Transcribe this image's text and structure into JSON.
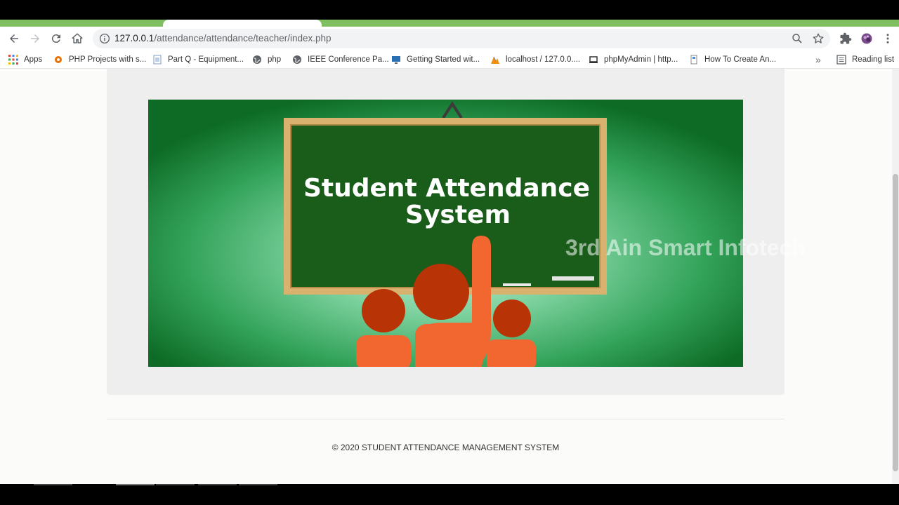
{
  "browser": {
    "url_host": "127.0.0.1",
    "url_path": "/attendance/attendance/teacher/index.php",
    "bookmarks": [
      {
        "label": "Apps",
        "icon": "apps-grid-icon"
      },
      {
        "label": "PHP Projects with s...",
        "icon": "php-projects-icon"
      },
      {
        "label": "Part Q - Equipment...",
        "icon": "document-icon"
      },
      {
        "label": "php",
        "icon": "globe-icon"
      },
      {
        "label": "IEEE Conference Pa...",
        "icon": "globe-icon"
      },
      {
        "label": "Getting Started wit...",
        "icon": "monitor-icon"
      },
      {
        "label": "localhost / 127.0.0....",
        "icon": "phpmyadmin-icon"
      },
      {
        "label": "phpMyAdmin | http...",
        "icon": "laptop-icon"
      },
      {
        "label": "How To Create An...",
        "icon": "page-icon"
      }
    ],
    "overflow_label": "»",
    "reading_list_label": "Reading list"
  },
  "banner": {
    "title_line1": "Student Attendance",
    "title_line2": "System",
    "watermark": "3rd Ain Smart Infotech"
  },
  "footer": {
    "copyright": "© 2020 STUDENT ATTENDANCE MANAGEMENT SYSTEM"
  }
}
